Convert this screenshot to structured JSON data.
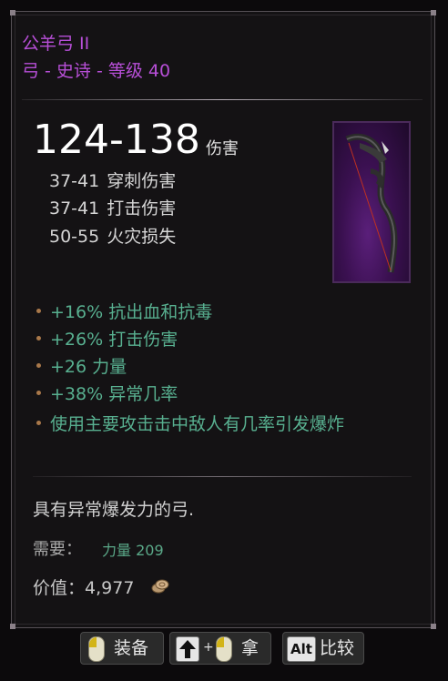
{
  "item": {
    "name": "公羊弓 II",
    "type_line": "弓 - 史诗 - 等级 40",
    "damage": "124-138",
    "damage_label": "伤害",
    "sub_damages": [
      {
        "range": "37-41",
        "label": "穿刺伤害"
      },
      {
        "range": "37-41",
        "label": "打击伤害"
      },
      {
        "range": "50-55",
        "label": "火灾损失"
      }
    ],
    "affixes": [
      "+16% 抗出血和抗毒",
      "+26% 打击伤害",
      "+26 力量",
      "+38% 异常几率",
      "使用主要攻击击中敌人有几率引发爆炸"
    ],
    "description": "具有异常爆发力的弓.",
    "requirement_label": "需要：",
    "requirement_value": "力量 209",
    "value_label": "价值：",
    "value": "4,977",
    "icon": "bow-item-icon"
  },
  "controls": {
    "equip_label": "装备",
    "take_label": "拿",
    "compare_label": "比较",
    "alt_key": "Alt",
    "plus": "+"
  },
  "colors": {
    "title": "#b84fd8",
    "affix": "#58b090",
    "requirement": "#5aa888",
    "bullet": "#a9784a"
  }
}
